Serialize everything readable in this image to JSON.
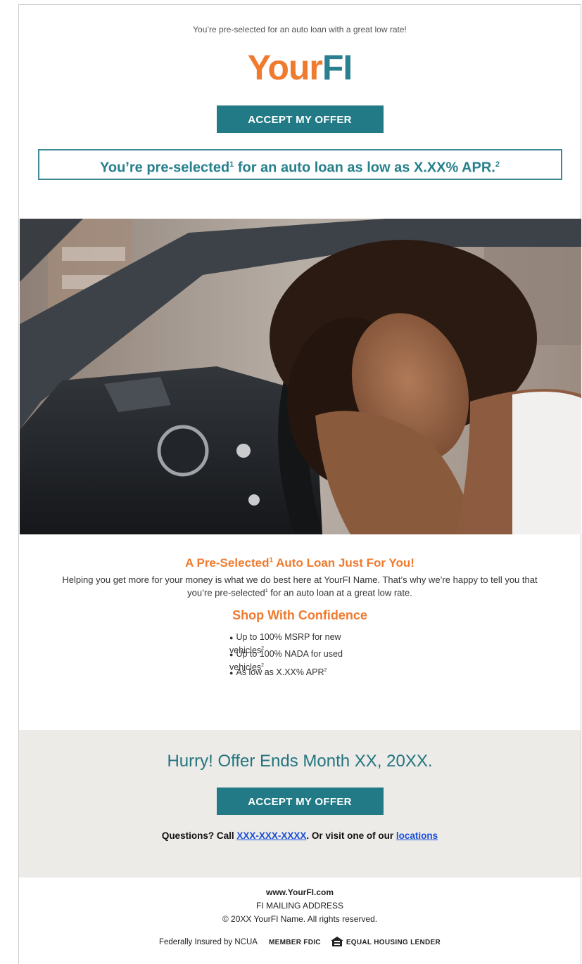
{
  "preheader": "You’re pre-selected for an auto loan with a great low rate!",
  "logo": {
    "part1": "Your",
    "part2": "FI"
  },
  "top_button": "ACCEPT MY OFFER",
  "headline": {
    "prefix": "You’re pre-selected",
    "sup1": "1",
    "middle": " for an auto loan as low as X.XX% APR.",
    "sup2": "2"
  },
  "hero_image": {
    "description": "woman-hugging-steering-wheel"
  },
  "section1": {
    "title_prefix": "A Pre-Selected",
    "title_sup": "1",
    "title_suffix": " Auto Loan Just For You!",
    "para_part1": "Helping you get more for your money is what we do best here at YourFI Name. That’s why we’re happy to tell you that you’re pre-selected",
    "para_sup": "1",
    "para_part2": " for an auto loan at a great low rate."
  },
  "section2": {
    "title": "Shop With Confidence",
    "bullets": [
      {
        "text": "Up to 100% MSRP for new vehicles",
        "sup": "2"
      },
      {
        "text": "Up to 100% NADA for used vehicles",
        "sup": "2"
      },
      {
        "text": "As low as X.XX% APR",
        "sup": "2"
      }
    ]
  },
  "cta": {
    "hurry": "Hurry! Offer Ends Month XX, 20XX.",
    "button": "ACCEPT MY OFFER",
    "questions_prefix": "Questions? Call ",
    "phone": "XXX-XXX-XXXX",
    "questions_middle": ". Or visit one of our ",
    "locations": "locations"
  },
  "footer": {
    "url": "www.YourFI.com",
    "address": "FI MAILING ADDRESS",
    "copyright": "© 20XX YourFI Name. All rights reserved.",
    "ncua": "Federally Insured by NCUA",
    "fdic": "MEMBER FDIC",
    "ehl": "EQUAL HOUSING LENDER"
  },
  "colors": {
    "teal": "#237a87",
    "orange": "#f07a2e",
    "gray_band": "#ecebe8",
    "link": "#1a4fd8"
  }
}
